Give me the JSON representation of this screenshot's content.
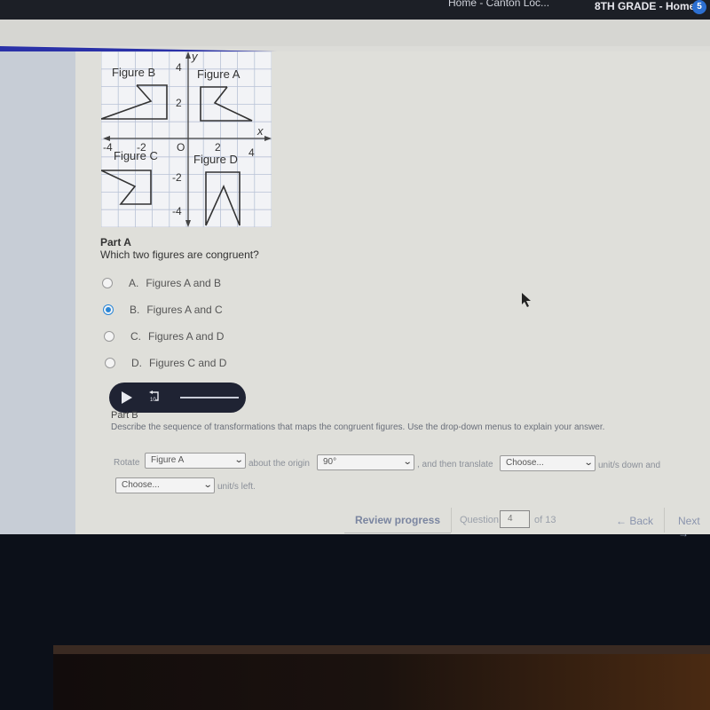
{
  "browser": {
    "tab_partial": "Home - Canton Loc...",
    "tab_active": "8TH GRADE - Home",
    "badge": "5"
  },
  "graph": {
    "axis_x": "x",
    "axis_y": "y",
    "x_ticks": [
      "-4",
      "-2",
      "O",
      "2",
      "4"
    ],
    "y_ticks": [
      "4",
      "2",
      "-2",
      "-4"
    ],
    "figure_labels": [
      "Figure B",
      "Figure A",
      "Figure C",
      "Figure D"
    ]
  },
  "part_a": {
    "title": "Part A",
    "question": "Which two figures are congruent?",
    "options": [
      {
        "letter": "A.",
        "text": "Figures A and B",
        "selected": false
      },
      {
        "letter": "B.",
        "text": "Figures A and C",
        "selected": true
      },
      {
        "letter": "C.",
        "text": "Figures A and D",
        "selected": false
      },
      {
        "letter": "D.",
        "text": "Figures C and D",
        "selected": false
      }
    ]
  },
  "audio": {
    "play_icon": "play-icon",
    "rewind_label": "10"
  },
  "part_b": {
    "title": "Part B",
    "description": "Describe the sequence of transformations that maps the congruent figures. Use the drop-down menus to explain your answer.",
    "text_rotate": "Rotate",
    "select_figure": "Figure A",
    "text_about": "about the origin",
    "select_angle": "90°",
    "text_then": ", and then translate",
    "select_down": "Choose...",
    "text_down": "unit/s down and",
    "select_left": "Choose...",
    "text_left": "unit/s left."
  },
  "footer": {
    "review": "Review progress",
    "question_label": "Question",
    "question_number": "4",
    "of_total": "of 13",
    "back": "← Back",
    "next": "Next →"
  }
}
